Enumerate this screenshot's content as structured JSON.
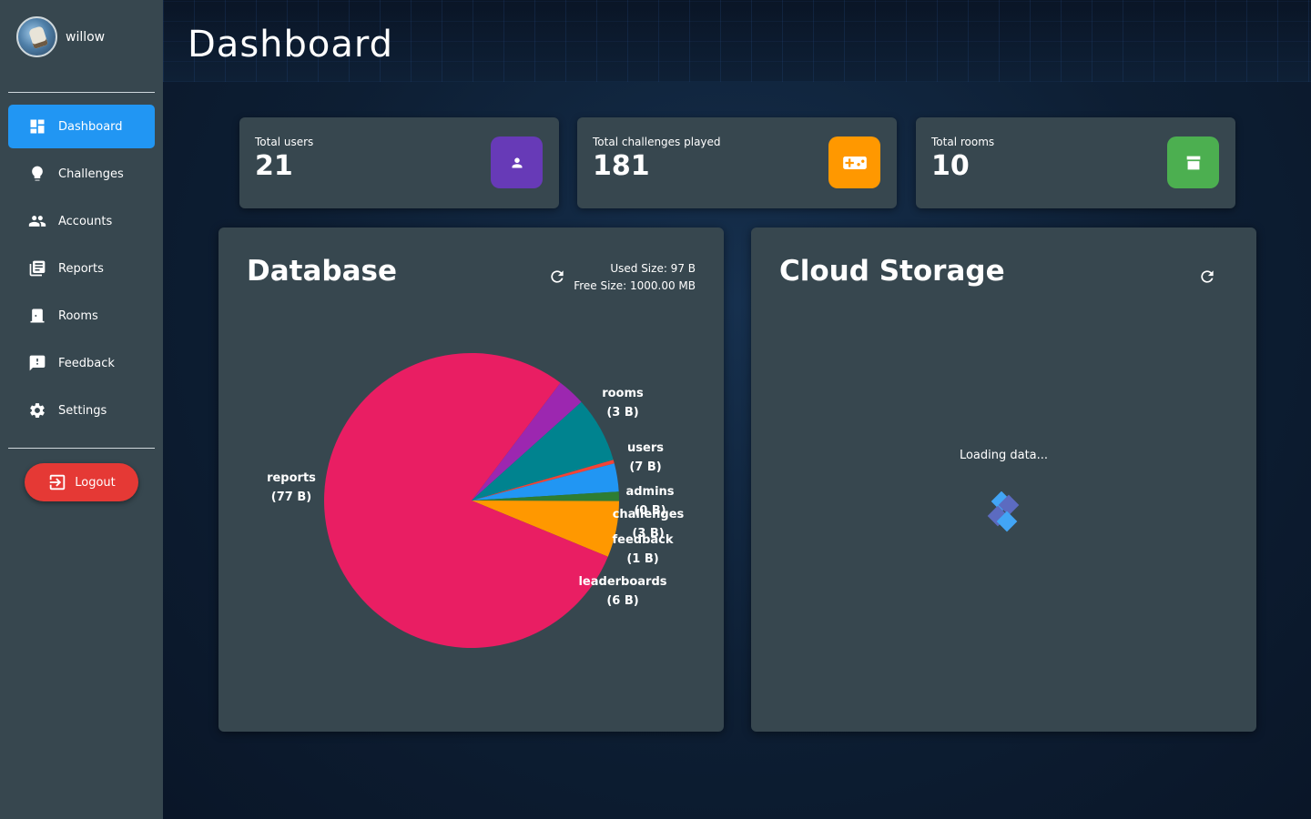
{
  "user": {
    "name": "willow"
  },
  "nav": {
    "items": [
      {
        "label": "Dashboard",
        "icon": "dashboard-icon",
        "active": true
      },
      {
        "label": "Challenges",
        "icon": "lightbulb-icon"
      },
      {
        "label": "Accounts",
        "icon": "people-icon"
      },
      {
        "label": "Reports",
        "icon": "reports-icon"
      },
      {
        "label": "Rooms",
        "icon": "door-icon"
      },
      {
        "label": "Feedback",
        "icon": "feedback-icon"
      },
      {
        "label": "Settings",
        "icon": "gear-icon"
      }
    ],
    "logout_label": "Logout"
  },
  "header": {
    "title": "Dashboard"
  },
  "stats": [
    {
      "label": "Total users",
      "value": "21",
      "icon": "person-icon",
      "color": "#673ab7"
    },
    {
      "label": "Total challenges played",
      "value": "181",
      "icon": "gamepad-icon",
      "color": "#ff9800"
    },
    {
      "label": "Total rooms",
      "value": "10",
      "icon": "package-icon",
      "color": "#4caf50"
    }
  ],
  "database": {
    "title": "Database",
    "used_size": "Used Size: 97 B",
    "free_size": "Free Size: 1000.00 MB"
  },
  "cloud": {
    "title": "Cloud Storage",
    "loading_text": "Loading data..."
  },
  "chart_data": {
    "type": "pie",
    "slices": [
      {
        "name": "reports",
        "label": "(77 B)",
        "value": 77,
        "color": "#e91e63"
      },
      {
        "name": "rooms",
        "label": "(3 B)",
        "value": 3,
        "color": "#9c27b0"
      },
      {
        "name": "users",
        "label": "(7 B)",
        "value": 7,
        "color": "#00838f"
      },
      {
        "name": "admins",
        "label": "(0 B)",
        "value": 0.4,
        "color": "#f44336"
      },
      {
        "name": "challenges",
        "label": "(3 B)",
        "value": 3,
        "color": "#2196f3"
      },
      {
        "name": "feedback",
        "label": "(1 B)",
        "value": 1,
        "color": "#2e7d32"
      },
      {
        "name": "leaderboards",
        "label": "(6 B)",
        "value": 6,
        "color": "#ff9800"
      }
    ]
  }
}
